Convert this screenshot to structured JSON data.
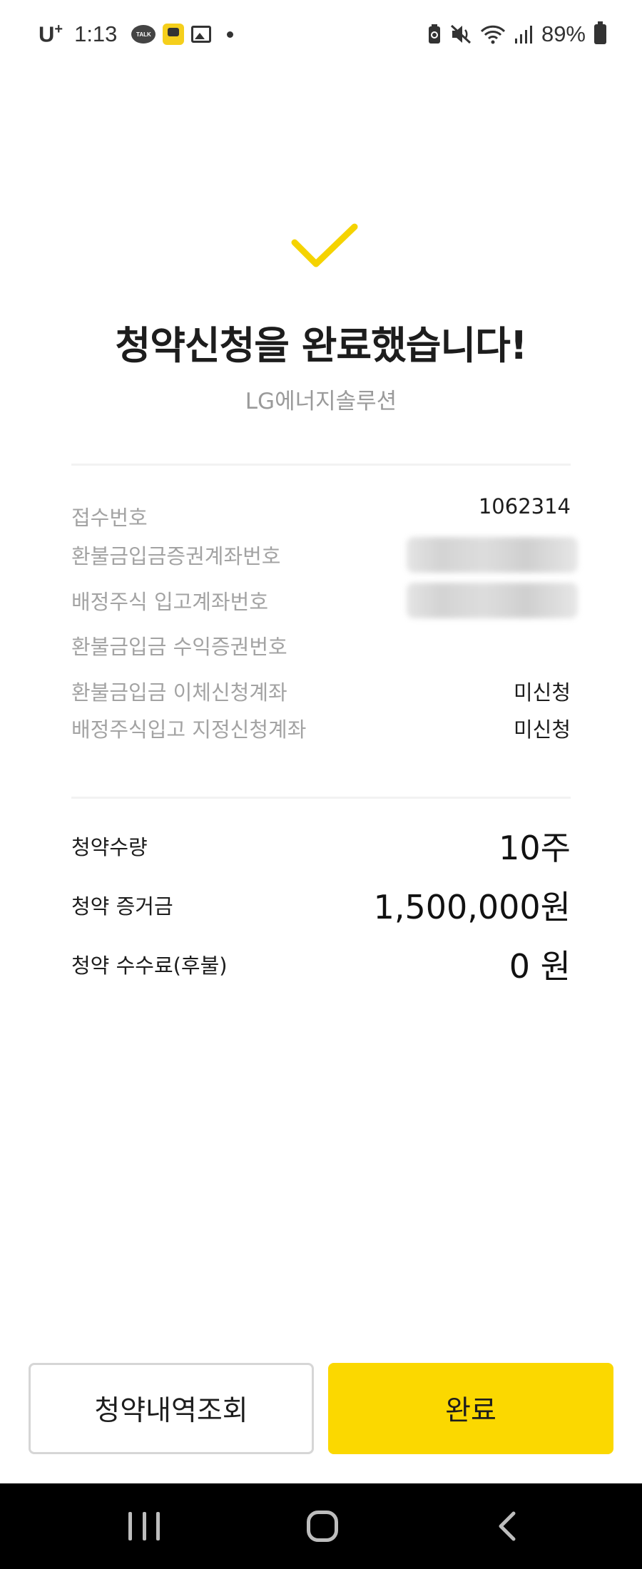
{
  "status_bar": {
    "carrier": "U",
    "carrier_plus": "+",
    "time": "1:13",
    "talk_label": "TALK",
    "battery": "89%"
  },
  "header": {
    "title": "청약신청을 완료했습니다!",
    "subtitle": "LG에너지솔루션"
  },
  "details": [
    {
      "label": "접수번호",
      "value": "1062314"
    },
    {
      "label": "환불금입금증권계좌번호",
      "value": ""
    },
    {
      "label": "배정주식 입고계좌번호",
      "value": ""
    },
    {
      "label": "환불금입금 수익증권번호",
      "value": ""
    },
    {
      "label": "환불금입금 이체신청계좌",
      "value": "미신청"
    },
    {
      "label": "배정주식입고 지정신청계좌",
      "value": "미신청"
    }
  ],
  "summary": [
    {
      "label": "청약수량",
      "value": "10주"
    },
    {
      "label": "청약 증거금",
      "value": "1,500,000원"
    },
    {
      "label": "청약 수수료(후불)",
      "value": "0 원"
    }
  ],
  "buttons": {
    "history": "청약내역조회",
    "done": "완료"
  },
  "colors": {
    "accent": "#fbd800",
    "check": "#f5d300"
  },
  "icons": [
    "talk-icon",
    "kakao-app-icon",
    "gallery-icon",
    "battery-saver-icon",
    "mute-icon",
    "wifi-icon",
    "signal-icon",
    "battery-icon",
    "checkmark-icon",
    "recent-apps-icon",
    "home-icon",
    "back-icon"
  ]
}
